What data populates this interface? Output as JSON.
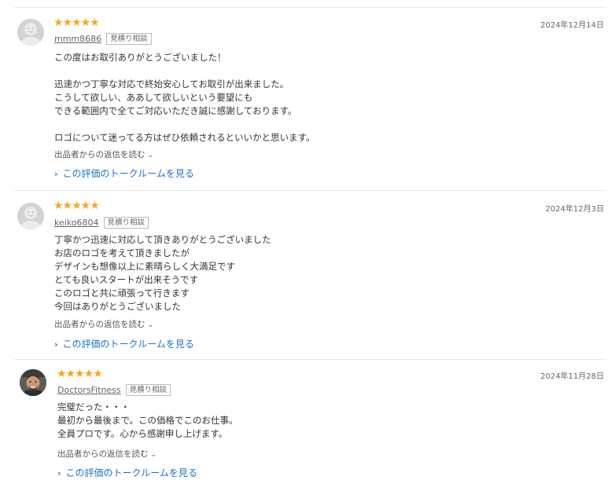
{
  "stars": "★★★★★",
  "reviews": [
    {
      "date": "2024年12月14日",
      "username": "mmm8686",
      "tag": "見積り相談",
      "lines": [
        "この度はお取引ありがとうございました！",
        "",
        "迅速かつ丁寧な対応で終始安心してお取引が出来ました。",
        "こうして欲しい、ああして欲しいという要望にも",
        "できる範囲内で全てご対応いただき誠に感謝しております。",
        "",
        "ロゴについて迷ってる方はぜひ依頼されるといいかと思います。"
      ],
      "reply_label": "出品者からの返信を読む",
      "talk_label": "この評価のトークルームを見る"
    },
    {
      "date": "2024年12月3日",
      "username": "keiko6804",
      "tag": "見積り相談",
      "lines": [
        "丁寧かつ迅速に対応して頂きありがとうございました",
        "お店のロゴを考えて頂きましたが",
        "デザインも想像以上に素晴らしく大満足です",
        "とても良いスタートが出来そうです",
        "このロゴと共に頑張って行きます",
        "今回はありがとうございました"
      ],
      "reply_label": "出品者からの返信を読む",
      "talk_label": "この評価のトークルームを見る"
    },
    {
      "date": "2024年11月28日",
      "username": "DoctorsFitness",
      "tag": "見積り相談",
      "lines": [
        "完璧だった・・・",
        "最初から最後まで。この価格でこのお仕事。",
        "全員プロです。心から感謝申し上げます。"
      ],
      "reply_label": "出品者からの返信を読む",
      "talk_label": "この評価のトークルームを見る"
    }
  ]
}
